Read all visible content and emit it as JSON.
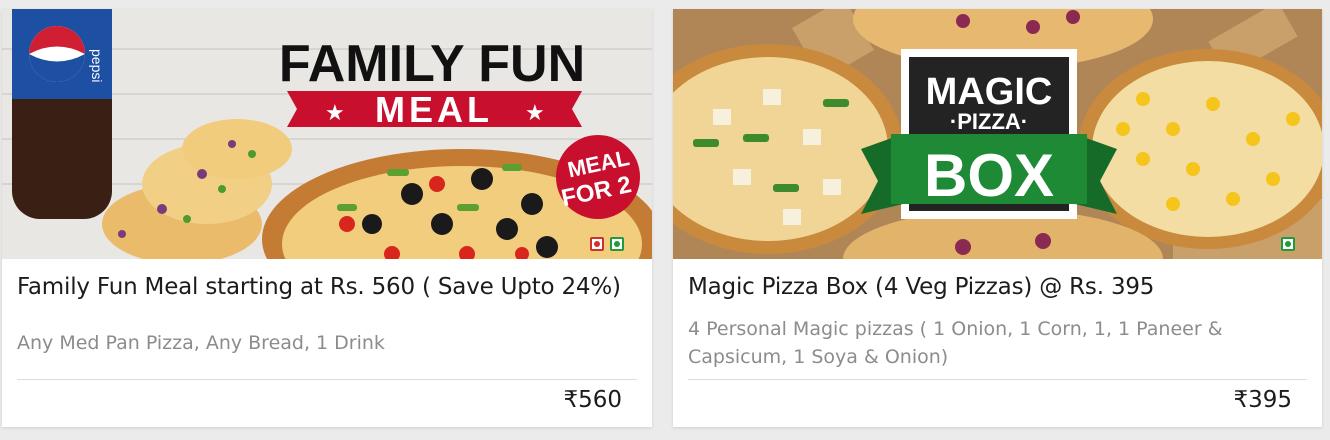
{
  "cards": [
    {
      "banner": {
        "headline_line1": "FAMILY FUN",
        "headline_line2": "MEAL",
        "badge_line1": "MEAL",
        "badge_line2": "FOR 2",
        "bottle_brand": "pepsi"
      },
      "title": "Family Fun Meal starting at Rs. 560 ( Save Upto 24%)",
      "description": "Any Med Pan Pizza, Any Bread, 1 Drink",
      "price": "₹560"
    },
    {
      "banner": {
        "logo_line1": "MAGIC",
        "logo_line2": "·PIZZA·",
        "logo_line3": "BOX"
      },
      "title": "Magic Pizza Box (4 Veg Pizzas) @ Rs. 395",
      "description": "4 Personal Magic pizzas ( 1 Onion, 1 Corn, 1, 1 Paneer & Capsicum, 1 Soya & Onion)",
      "price": "₹395"
    }
  ],
  "colors": {
    "banner_red": "#c8102e",
    "ribbon_green": "#1f8a36",
    "veg_green": "#1e9b3a",
    "nonveg_red": "#d32f2f"
  }
}
